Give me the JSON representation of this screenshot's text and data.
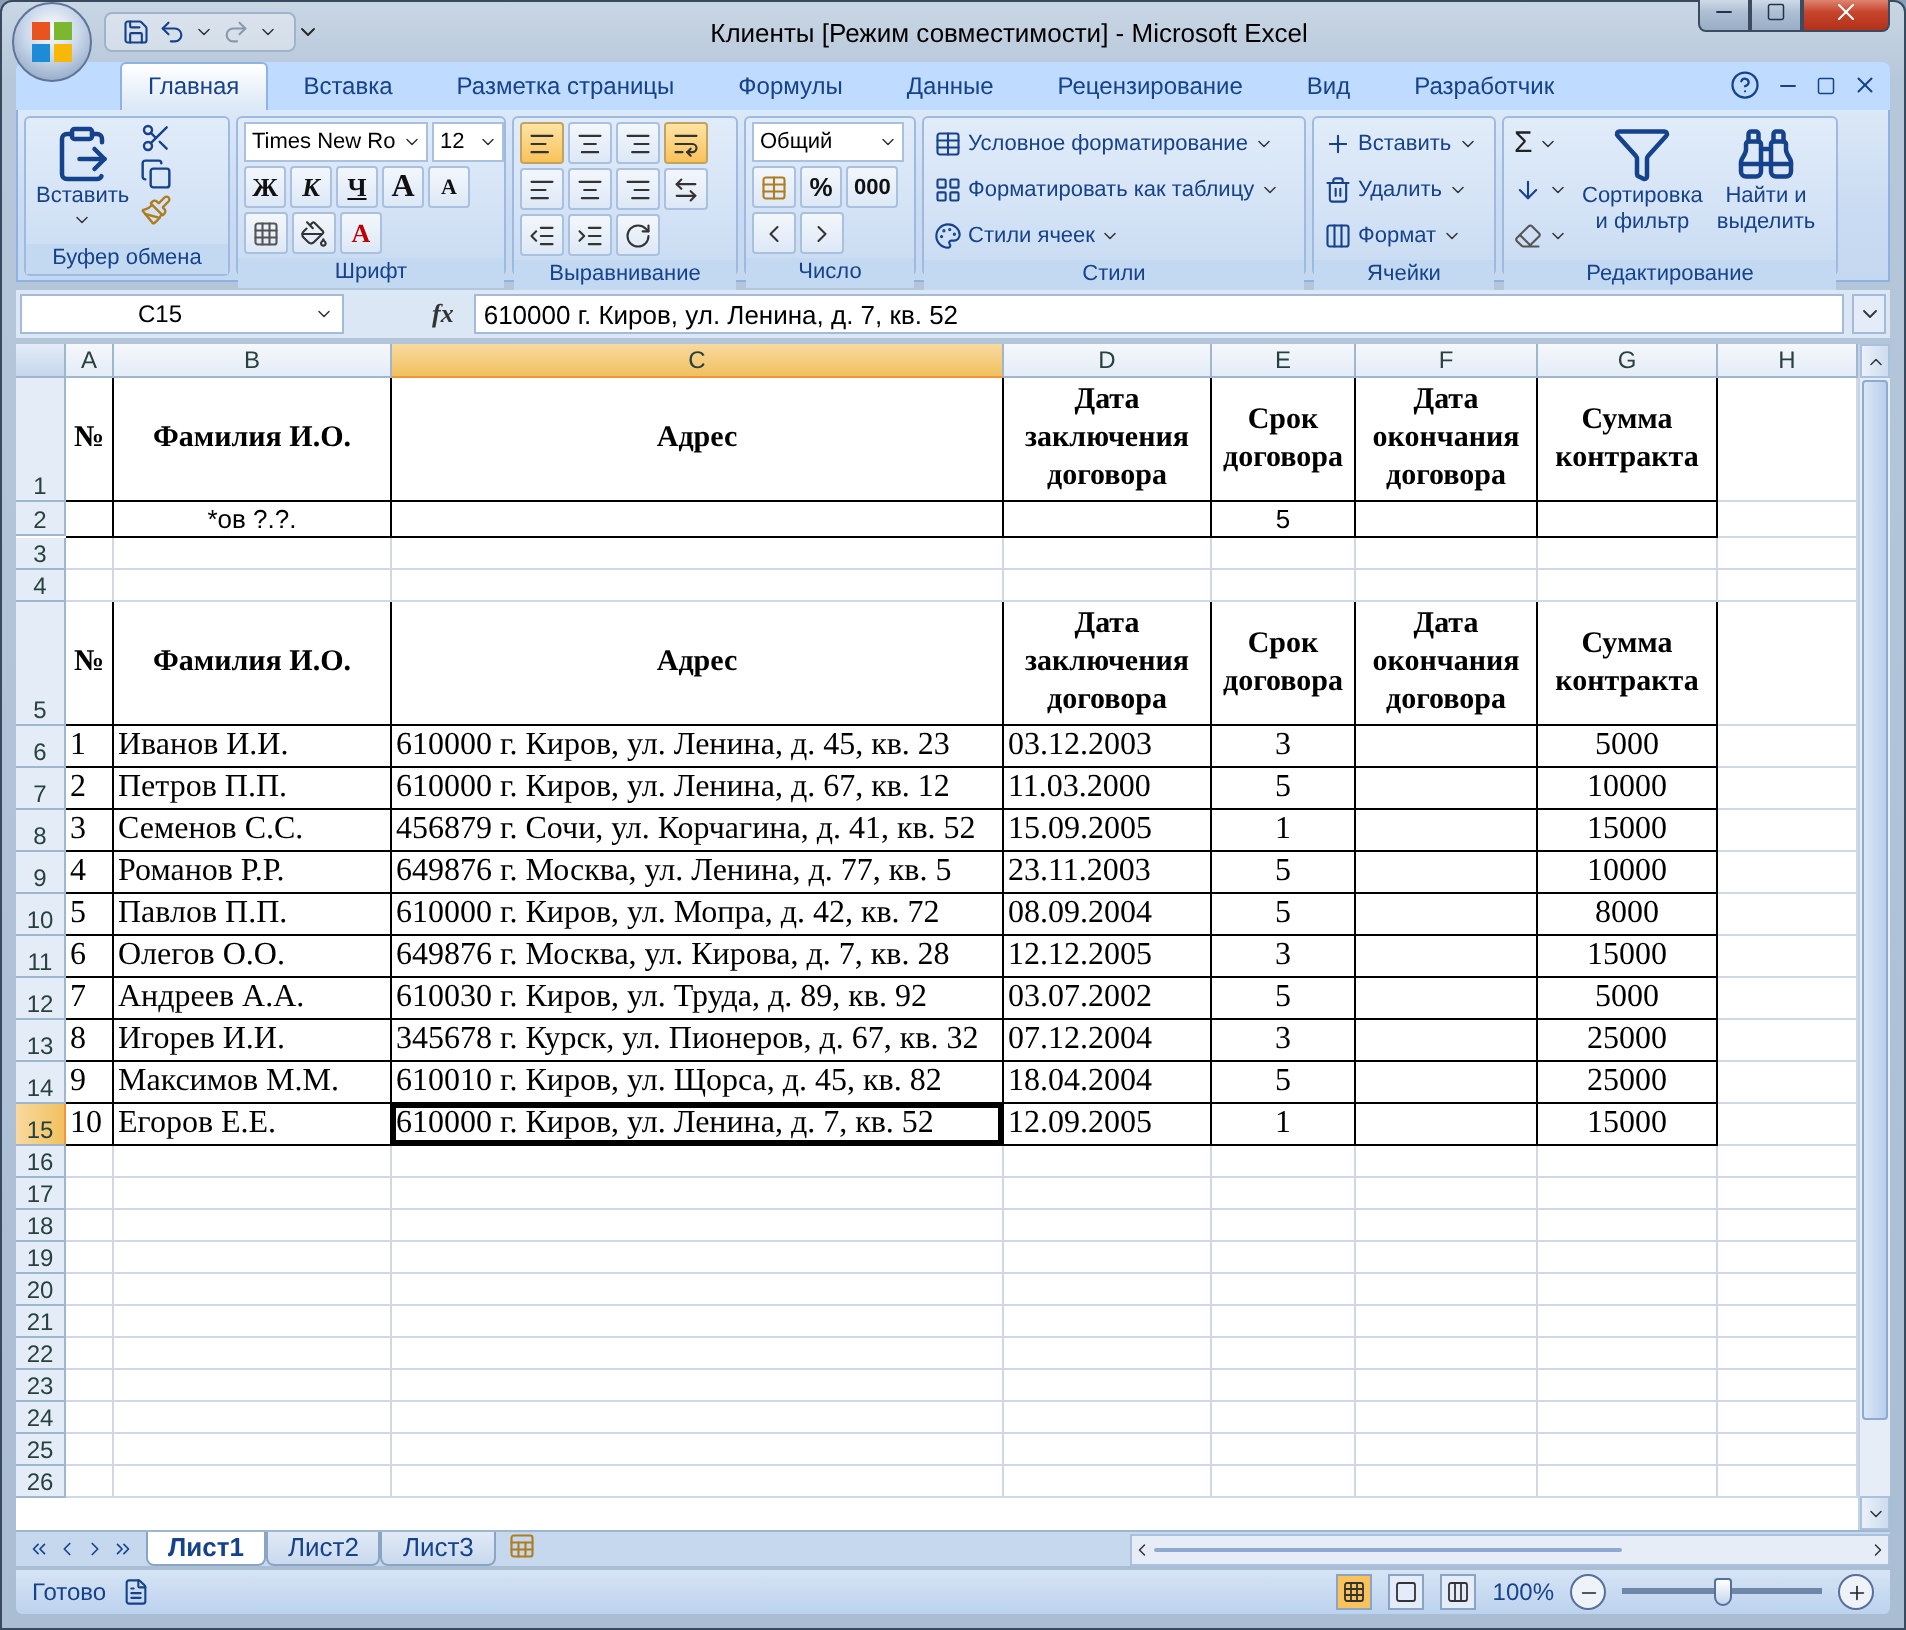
{
  "window": {
    "title": "Клиенты  [Режим совместимости] - Microsoft Excel"
  },
  "ribbon_tabs": [
    {
      "label": "Главная",
      "selected": true
    },
    {
      "label": "Вставка",
      "selected": false
    },
    {
      "label": "Разметка страницы",
      "selected": false
    },
    {
      "label": "Формулы",
      "selected": false
    },
    {
      "label": "Данные",
      "selected": false
    },
    {
      "label": "Рецензирование",
      "selected": false
    },
    {
      "label": "Вид",
      "selected": false
    },
    {
      "label": "Разработчик",
      "selected": false
    }
  ],
  "ribbon": {
    "clipboard": {
      "label": "Буфер обмена",
      "paste": "Вставить"
    },
    "font": {
      "label": "Шрифт",
      "font_name": "Times New Ro",
      "font_size": "12",
      "bold": "Ж",
      "italic": "К",
      "underline": "Ч",
      "grow": "A",
      "shrink": "A",
      "font_color": "A"
    },
    "alignment": {
      "label": "Выравнивание",
      "buttons": [
        {
          "kind": "top",
          "selected": true
        },
        {
          "kind": "middle",
          "selected": false
        },
        {
          "kind": "bottom",
          "selected": false
        },
        {
          "kind": "wrap",
          "selected": true
        },
        {
          "kind": "left",
          "selected": false
        },
        {
          "kind": "center",
          "selected": false
        },
        {
          "kind": "right",
          "selected": false
        },
        {
          "kind": "merge",
          "selected": false
        },
        {
          "kind": "outdent",
          "selected": false
        },
        {
          "kind": "indent",
          "selected": false
        },
        {
          "kind": "orientation",
          "selected": false
        }
      ]
    },
    "number": {
      "label": "Число",
      "format": "Общий",
      "percent": "%",
      "thousands": "000"
    },
    "styles": {
      "label": "Стили",
      "items": [
        "Условное форматирование",
        "Форматировать как таблицу",
        "Стили ячеек"
      ]
    },
    "cells": {
      "label": "Ячейки",
      "items": [
        "Вставить",
        "Удалить",
        "Формат"
      ]
    },
    "editing": {
      "label": "Редактирование",
      "sum": "Σ",
      "items": [
        "Сортировка\nи фильтр",
        "Найти и\nвыделить"
      ]
    }
  },
  "formula_bar": {
    "name_box": "C15",
    "fx": "fx",
    "formula": "610000 г. Киров, ул. Ленина, д. 7, кв. 52"
  },
  "sheet": {
    "columns": [
      {
        "label": "A",
        "selected": false
      },
      {
        "label": "B",
        "selected": false
      },
      {
        "label": "C",
        "selected": true
      },
      {
        "label": "D",
        "selected": false
      },
      {
        "label": "E",
        "selected": false
      },
      {
        "label": "F",
        "selected": false
      },
      {
        "label": "G",
        "selected": false
      },
      {
        "label": "H",
        "selected": false
      }
    ],
    "rows": [
      {
        "number": "1",
        "kind": "header",
        "framed": true,
        "selected": false,
        "cells": [
          "№",
          "Фамилия И.О.",
          "Адрес",
          "Дата заключения договора",
          "Срок договора",
          "Дата окончания договора",
          "Сумма контракта",
          null
        ]
      },
      {
        "number": "2",
        "kind": "plain",
        "framed": true,
        "selected": false,
        "cells": [
          null,
          "*ов ?.?.",
          null,
          null,
          "5",
          null,
          null,
          null
        ]
      },
      {
        "number": "3",
        "kind": "blank",
        "framed": false,
        "selected": false
      },
      {
        "number": "4",
        "kind": "blank",
        "framed": false,
        "selected": false
      },
      {
        "number": "5",
        "kind": "header",
        "framed": true,
        "selected": false,
        "cells": [
          "№",
          "Фамилия И.О.",
          "Адрес",
          "Дата заключения договора",
          "Срок договора",
          "Дата окончания договора",
          "Сумма контракта",
          null
        ]
      },
      {
        "number": "6",
        "kind": "data",
        "framed": true,
        "selected": false,
        "cells": [
          "1",
          "Иванов И.И.",
          "610000 г. Киров, ул. Ленина, д. 45, кв. 23",
          "03.12.2003",
          "3",
          null,
          "5000",
          null
        ]
      },
      {
        "number": "7",
        "kind": "data",
        "framed": true,
        "selected": false,
        "cells": [
          "2",
          "Петров П.П.",
          "610000 г. Киров, ул. Ленина, д. 67, кв. 12",
          "11.03.2000",
          "5",
          null,
          "10000",
          null
        ]
      },
      {
        "number": "8",
        "kind": "data",
        "framed": true,
        "selected": false,
        "cells": [
          "3",
          "Семенов С.С.",
          "456879 г. Сочи, ул. Корчагина, д. 41, кв. 52",
          "15.09.2005",
          "1",
          null,
          "15000",
          null
        ]
      },
      {
        "number": "9",
        "kind": "data",
        "framed": true,
        "selected": false,
        "cells": [
          "4",
          "Романов Р.Р.",
          "649876 г. Москва, ул. Ленина, д. 77, кв. 5",
          "23.11.2003",
          "5",
          null,
          "10000",
          null
        ]
      },
      {
        "number": "10",
        "kind": "data",
        "framed": true,
        "selected": false,
        "cells": [
          "5",
          "Павлов П.П.",
          "610000 г. Киров, ул. Мопра, д. 42, кв. 72",
          "08.09.2004",
          "5",
          null,
          "8000",
          null
        ]
      },
      {
        "number": "11",
        "kind": "data",
        "framed": true,
        "selected": false,
        "cells": [
          "6",
          "Олегов О.О.",
          "649876 г. Москва, ул. Кирова, д. 7, кв. 28",
          "12.12.2005",
          "3",
          null,
          "15000",
          null
        ]
      },
      {
        "number": "12",
        "kind": "data",
        "framed": true,
        "selected": false,
        "cells": [
          "7",
          "Андреев А.А.",
          "610030 г. Киров, ул. Труда, д. 89, кв. 92",
          "03.07.2002",
          "5",
          null,
          "5000",
          null
        ]
      },
      {
        "number": "13",
        "kind": "data",
        "framed": true,
        "selected": false,
        "cells": [
          "8",
          "Игорев И.И.",
          "345678 г. Курск, ул. Пионеров, д. 67, кв. 32",
          "07.12.2004",
          "3",
          null,
          "25000",
          null
        ]
      },
      {
        "number": "14",
        "kind": "data",
        "framed": true,
        "selected": false,
        "cells": [
          "9",
          "Максимов М.М.",
          "610010 г. Киров, ул. Щорса, д. 45, кв. 82",
          "18.04.2004",
          "5",
          null,
          "25000",
          null
        ]
      },
      {
        "number": "15",
        "kind": "data",
        "framed": true,
        "selected": true,
        "cells": [
          "10",
          "Егоров Е.Е.",
          "610000 г. Киров, ул. Ленина, д. 7, кв. 52",
          "12.09.2005",
          "1",
          null,
          "15000",
          null
        ]
      },
      {
        "number": "16",
        "kind": "blank",
        "framed": false,
        "selected": false
      },
      {
        "number": "17",
        "kind": "blank",
        "framed": false,
        "selected": false
      },
      {
        "number": "18",
        "kind": "blank",
        "framed": false,
        "selected": false
      },
      {
        "number": "19",
        "kind": "blank",
        "framed": false,
        "selected": false
      },
      {
        "number": "20",
        "kind": "blank",
        "framed": false,
        "selected": false
      },
      {
        "number": "21",
        "kind": "blank",
        "framed": false,
        "selected": false
      },
      {
        "number": "22",
        "kind": "blank",
        "framed": false,
        "selected": false
      },
      {
        "number": "23",
        "kind": "blank",
        "framed": false,
        "selected": false
      },
      {
        "number": "24",
        "kind": "blank",
        "framed": false,
        "selected": false
      },
      {
        "number": "25",
        "kind": "blank",
        "framed": false,
        "selected": false
      },
      {
        "number": "26",
        "kind": "blank",
        "framed": false,
        "selected": false
      }
    ]
  },
  "sheet_tabs": [
    {
      "label": "Лист1",
      "selected": true
    },
    {
      "label": "Лист2",
      "selected": false
    },
    {
      "label": "Лист3",
      "selected": false
    }
  ],
  "status_bar": {
    "status": "Готово",
    "zoom": "100%",
    "zoom_slider": {
      "level": 0.5
    }
  }
}
